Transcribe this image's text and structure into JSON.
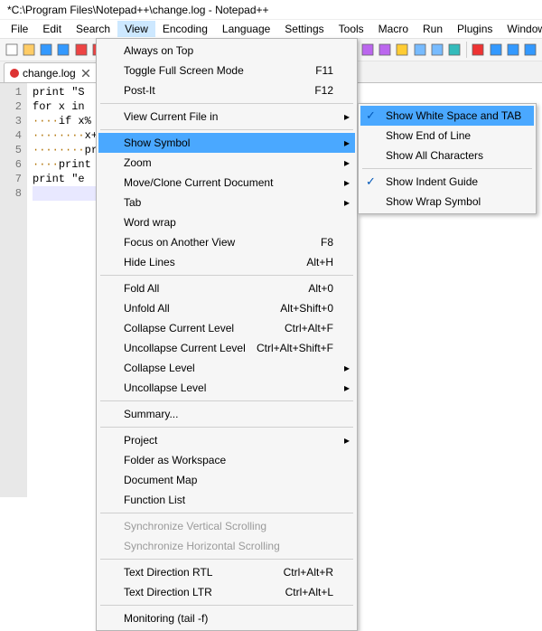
{
  "title": "*C:\\Program Files\\Notepad++\\change.log - Notepad++",
  "menubar": [
    "File",
    "Edit",
    "Search",
    "View",
    "Encoding",
    "Language",
    "Settings",
    "Tools",
    "Macro",
    "Run",
    "Plugins",
    "Window",
    "?"
  ],
  "active_menu": "View",
  "tab": {
    "label": "change.log"
  },
  "gutter": [
    "1",
    "2",
    "3",
    "4",
    "5",
    "6",
    "7",
    "8"
  ],
  "code_lines": [
    "print \"S",
    "for x in",
    "····if x%",
    "········x+=",
    "········pri",
    "····print",
    "print \"e",
    ""
  ],
  "view_menu": [
    {
      "label": "Always on Top"
    },
    {
      "label": "Toggle Full Screen Mode",
      "shortcut": "F11"
    },
    {
      "label": "Post-It",
      "shortcut": "F12"
    },
    {
      "sep": true
    },
    {
      "label": "View Current File in",
      "arrow": true
    },
    {
      "sep": true
    },
    {
      "label": "Show Symbol",
      "arrow": true,
      "hl": true
    },
    {
      "label": "Zoom",
      "arrow": true
    },
    {
      "label": "Move/Clone Current Document",
      "arrow": true
    },
    {
      "label": "Tab",
      "arrow": true
    },
    {
      "label": "Word wrap"
    },
    {
      "label": "Focus on Another View",
      "shortcut": "F8"
    },
    {
      "label": "Hide Lines",
      "shortcut": "Alt+H"
    },
    {
      "sep": true
    },
    {
      "label": "Fold All",
      "shortcut": "Alt+0"
    },
    {
      "label": "Unfold All",
      "shortcut": "Alt+Shift+0"
    },
    {
      "label": "Collapse Current Level",
      "shortcut": "Ctrl+Alt+F"
    },
    {
      "label": "Uncollapse Current Level",
      "shortcut": "Ctrl+Alt+Shift+F"
    },
    {
      "label": "Collapse Level",
      "arrow": true
    },
    {
      "label": "Uncollapse Level",
      "arrow": true
    },
    {
      "sep": true
    },
    {
      "label": "Summary..."
    },
    {
      "sep": true
    },
    {
      "label": "Project",
      "arrow": true
    },
    {
      "label": "Folder as Workspace"
    },
    {
      "label": "Document Map"
    },
    {
      "label": "Function List"
    },
    {
      "sep": true
    },
    {
      "label": "Synchronize Vertical Scrolling",
      "disabled": true
    },
    {
      "label": "Synchronize Horizontal Scrolling",
      "disabled": true
    },
    {
      "sep": true
    },
    {
      "label": "Text Direction RTL",
      "shortcut": "Ctrl+Alt+R"
    },
    {
      "label": "Text Direction LTR",
      "shortcut": "Ctrl+Alt+L"
    },
    {
      "sep": true
    },
    {
      "label": "Monitoring (tail -f)"
    }
  ],
  "show_symbol_submenu": [
    {
      "label": "Show White Space and TAB",
      "checked": true,
      "hl": true
    },
    {
      "label": "Show End of Line"
    },
    {
      "label": "Show All Characters"
    },
    {
      "sep": true
    },
    {
      "label": "Show Indent Guide",
      "checked": true
    },
    {
      "label": "Show Wrap Symbol"
    }
  ],
  "toolbar_icons": [
    "new",
    "open",
    "save",
    "save-all",
    "close",
    "close-all",
    "print",
    "cut",
    "copy",
    "paste",
    "undo",
    "redo",
    "find",
    "replace",
    "zoom-in",
    "zoom-out",
    "sync",
    "wrap",
    "whitespace",
    "indent",
    "guide",
    "folder",
    "doclist",
    "func",
    "eye",
    "record",
    "play",
    "stop",
    "playlist"
  ]
}
